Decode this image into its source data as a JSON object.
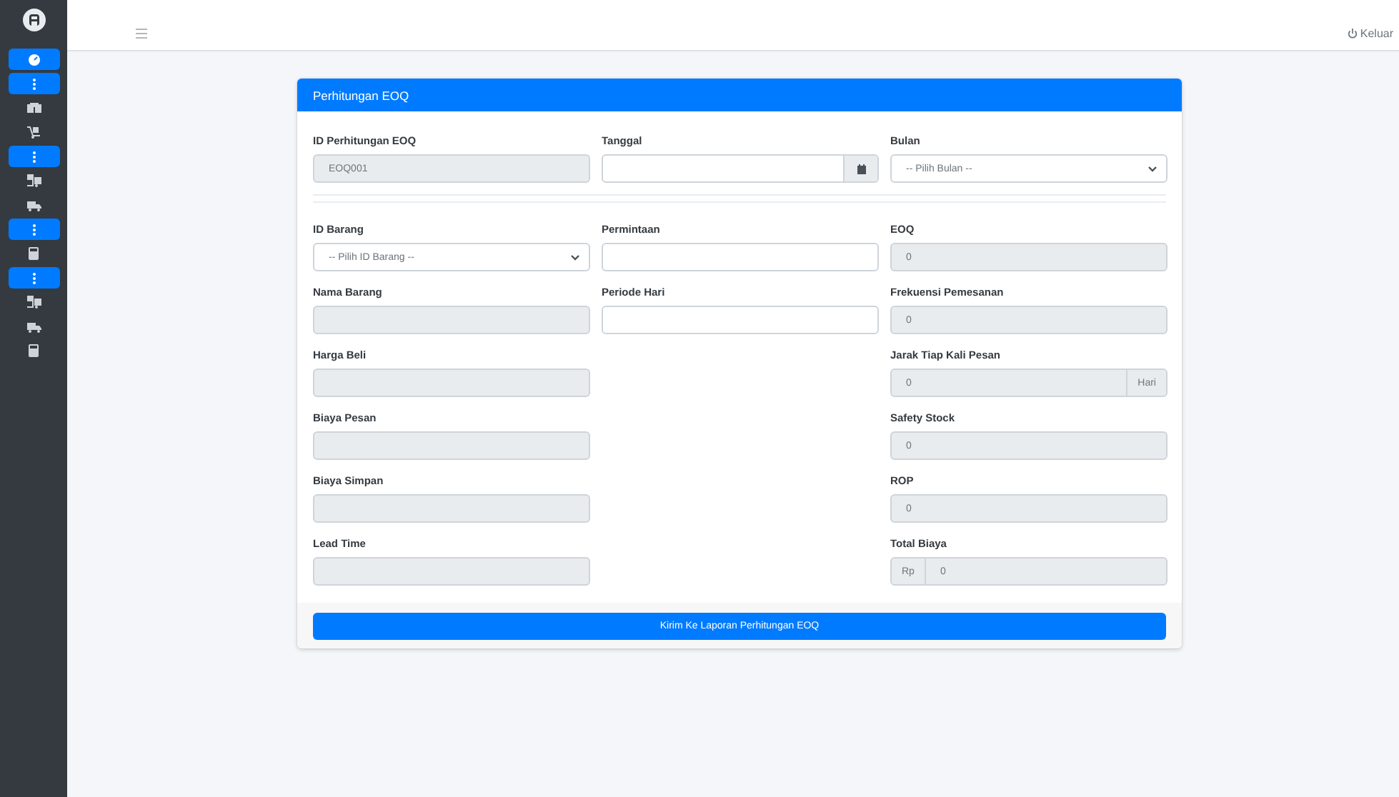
{
  "sidebar": {
    "items": [
      {
        "kind": "gauge",
        "selected": true
      },
      {
        "kind": "dots",
        "selected": true
      },
      {
        "kind": "box",
        "selected": false
      },
      {
        "kind": "dolly",
        "selected": false
      },
      {
        "kind": "dots",
        "selected": true
      },
      {
        "kind": "forklift",
        "selected": false
      },
      {
        "kind": "truck",
        "selected": false
      },
      {
        "kind": "dots",
        "selected": true
      },
      {
        "kind": "calculator",
        "selected": false
      },
      {
        "kind": "dots",
        "selected": true
      },
      {
        "kind": "forklift",
        "selected": false
      },
      {
        "kind": "truck",
        "selected": false
      },
      {
        "kind": "calculator",
        "selected": false
      }
    ]
  },
  "topbar": {
    "logout": "Keluar"
  },
  "card": {
    "title": "Perhitungan EOQ",
    "top_fields": [
      {
        "label": "ID Perhitungan EOQ",
        "kind": "input",
        "readonly": true,
        "value": "EOQ001"
      },
      {
        "label": "Tanggal",
        "kind": "date",
        "readonly": false
      },
      {
        "label": "Bulan",
        "kind": "select",
        "readonly": false,
        "value": "-- Pilih Bulan --"
      }
    ],
    "columns": [
      [
        {
          "label": "ID Barang",
          "kind": "select",
          "readonly": false,
          "value": "-- Pilih ID Barang --"
        },
        {
          "label": "Nama Barang",
          "kind": "input",
          "readonly": true
        },
        {
          "label": "Harga Beli",
          "kind": "input",
          "readonly": true
        },
        {
          "label": "Biaya Pesan",
          "kind": "input",
          "readonly": true
        },
        {
          "label": "Biaya Simpan",
          "kind": "input",
          "readonly": true
        },
        {
          "label": "Lead Time",
          "kind": "input",
          "readonly": true
        }
      ],
      [
        {
          "label": "Permintaan",
          "kind": "input",
          "readonly": false
        },
        {
          "label": "Periode Hari",
          "kind": "input",
          "readonly": false
        }
      ],
      [
        {
          "label": "EOQ",
          "kind": "input",
          "readonly": true,
          "value": "0"
        },
        {
          "label": "Frekuensi Pemesanan",
          "kind": "input",
          "readonly": true,
          "value": "0"
        },
        {
          "label": "Jarak Tiap Kali Pesan",
          "kind": "input",
          "readonly": true,
          "value": "0",
          "suffix": "Hari"
        },
        {
          "label": "Safety Stock",
          "kind": "input",
          "readonly": true,
          "value": "0"
        },
        {
          "label": "ROP",
          "kind": "input",
          "readonly": true,
          "value": "0"
        },
        {
          "label": "Total Biaya",
          "kind": "input",
          "readonly": true,
          "value": "0",
          "prefix": "Rp"
        }
      ]
    ],
    "submit": "Kirim Ke Laporan Perhitungan EOQ"
  }
}
